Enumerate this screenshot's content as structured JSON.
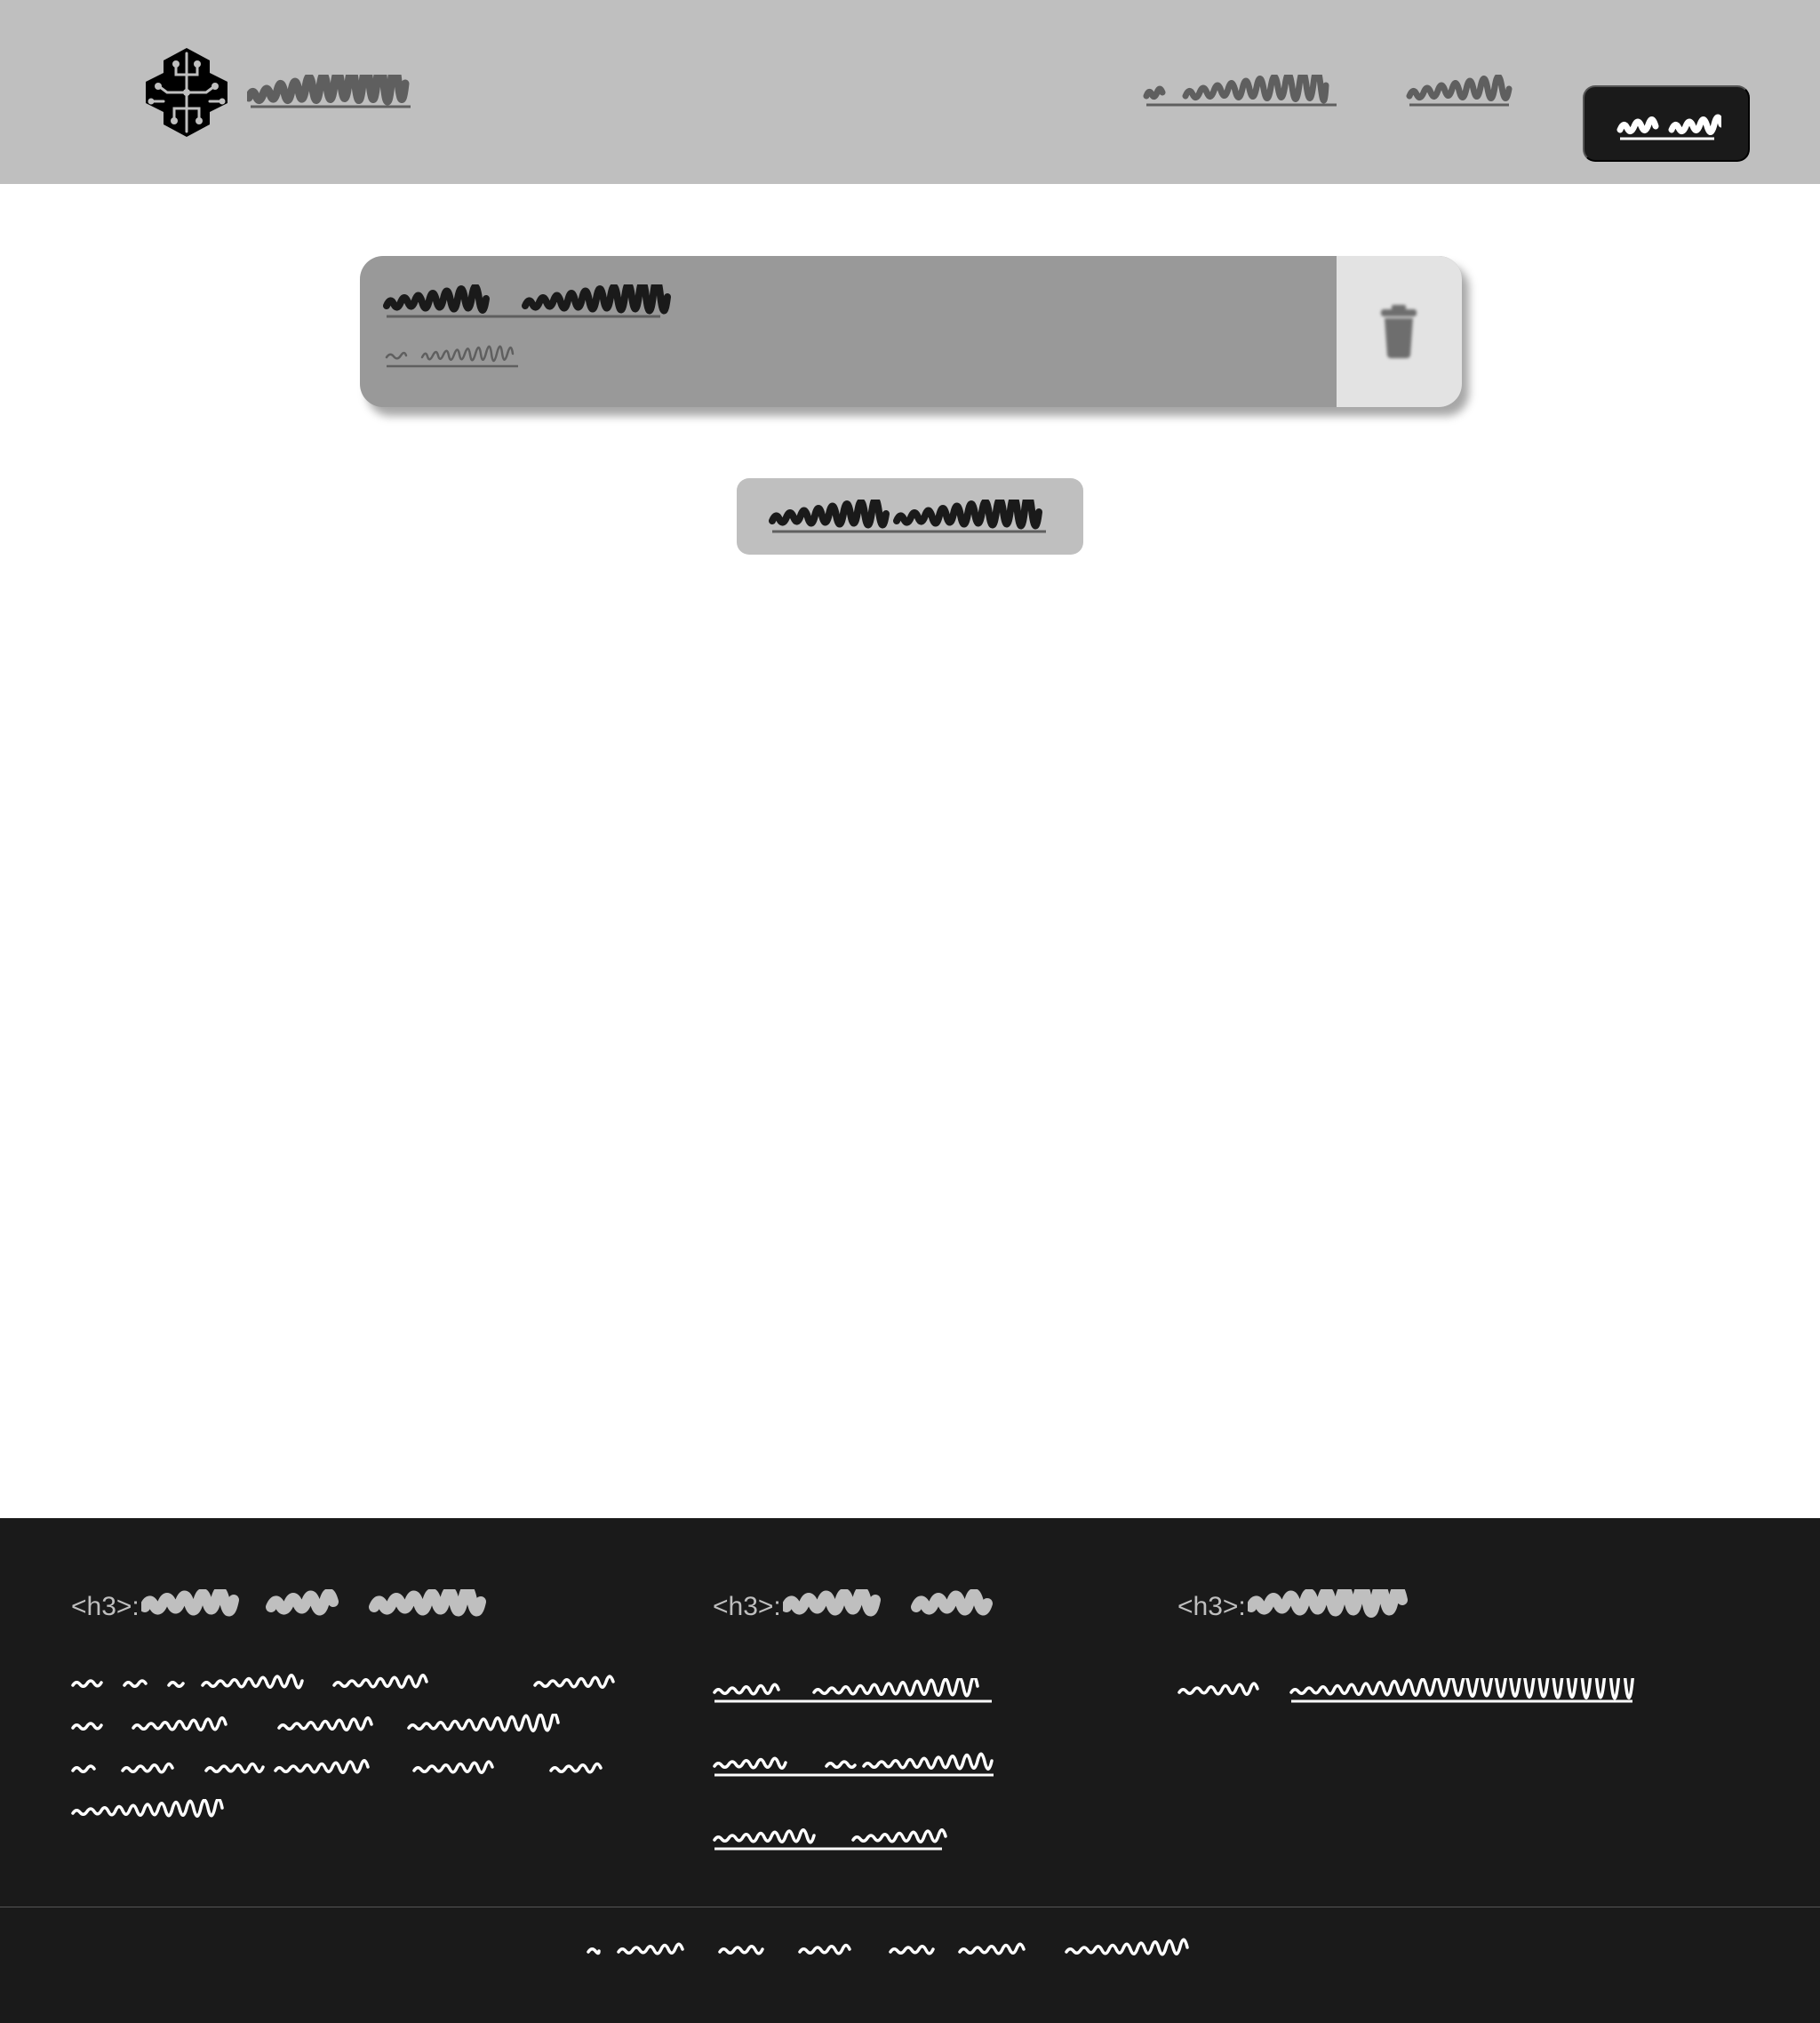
{
  "colors": {
    "header_bg": "#bfbfbf",
    "dark": "#1a1a1a",
    "card_bg": "#999999",
    "card_action_bg": "#e3e3e3",
    "link_grey": "#5f5f5f",
    "footer_text": "#ffffff"
  },
  "header": {
    "logo_icon": "brain-circuit-icon",
    "brand_text": "",
    "nav": [
      "",
      ""
    ],
    "cta_label": ""
  },
  "card": {
    "title": "",
    "subtitle": "",
    "action_icon": "trash-icon"
  },
  "center_button": {
    "label": ""
  },
  "footer": {
    "columns": [
      {
        "heading_tag": "<h3>:",
        "heading": "",
        "text": ""
      },
      {
        "heading_tag": "<h3>:",
        "heading": "",
        "links": [
          "",
          "",
          ""
        ]
      },
      {
        "heading_tag": "<h3>:",
        "heading": "",
        "label": "",
        "email": ""
      }
    ],
    "copyright": ""
  }
}
